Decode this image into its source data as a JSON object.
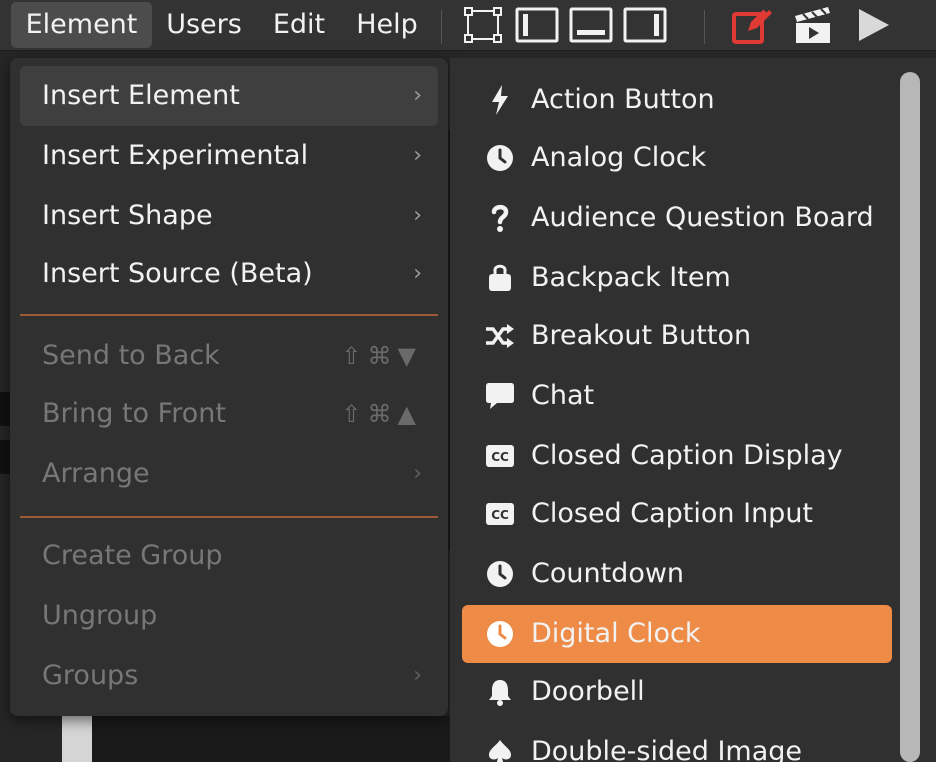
{
  "menubar": {
    "menus": [
      {
        "label": "Element",
        "active": true
      },
      {
        "label": "Users",
        "active": false
      },
      {
        "label": "Edit",
        "active": false
      },
      {
        "label": "Help",
        "active": false
      }
    ],
    "toolbar_icons": [
      "select-frame-icon",
      "dock-left-icon",
      "dock-bottom-icon",
      "dock-right-icon",
      "edit-icon",
      "clapperboard-icon",
      "play-icon"
    ],
    "edit_icon_color": "#e03a34"
  },
  "element_menu": {
    "items": [
      {
        "label": "Insert Element",
        "submenu": true,
        "chevron": "›",
        "hovered": true
      },
      {
        "label": "Insert Experimental",
        "submenu": true,
        "chevron": "›"
      },
      {
        "label": "Insert Shape",
        "submenu": true,
        "chevron": "›"
      },
      {
        "label": "Insert Source (Beta)",
        "submenu": true,
        "chevron": "›"
      },
      {
        "label": "Send to Back",
        "shortcut": "⇧⌘▼",
        "disabled": true
      },
      {
        "label": "Bring to Front",
        "shortcut": "⇧⌘▲",
        "disabled": true
      },
      {
        "label": "Arrange",
        "submenu": true,
        "chevron": "›",
        "disabled": true
      },
      {
        "label": "Create Group",
        "disabled": true
      },
      {
        "label": "Ungroup",
        "disabled": true
      },
      {
        "label": "Groups",
        "submenu": true,
        "chevron": "›",
        "disabled": true
      }
    ]
  },
  "insert_element_submenu": {
    "items": [
      {
        "label": "Action Button",
        "icon": "bolt-icon"
      },
      {
        "label": "Analog Clock",
        "icon": "clock-icon"
      },
      {
        "label": "Audience Question Board",
        "icon": "question-icon"
      },
      {
        "label": "Backpack Item",
        "icon": "bag-icon"
      },
      {
        "label": "Breakout Button",
        "icon": "shuffle-icon"
      },
      {
        "label": "Chat",
        "icon": "chat-icon"
      },
      {
        "label": "Closed Caption Display",
        "icon": "cc-icon"
      },
      {
        "label": "Closed Caption Input",
        "icon": "cc-icon"
      },
      {
        "label": "Countdown",
        "icon": "clock-icon"
      },
      {
        "label": "Digital Clock",
        "icon": "clock-icon",
        "selected": true
      },
      {
        "label": "Doorbell",
        "icon": "bell-icon"
      },
      {
        "label": "Double-sided Image",
        "icon": "spade-icon"
      }
    ]
  },
  "colors": {
    "accent": "#ee8b47",
    "separator": "#9c5a35",
    "menu_bg": "#303030",
    "menubar_bg": "#333333"
  }
}
